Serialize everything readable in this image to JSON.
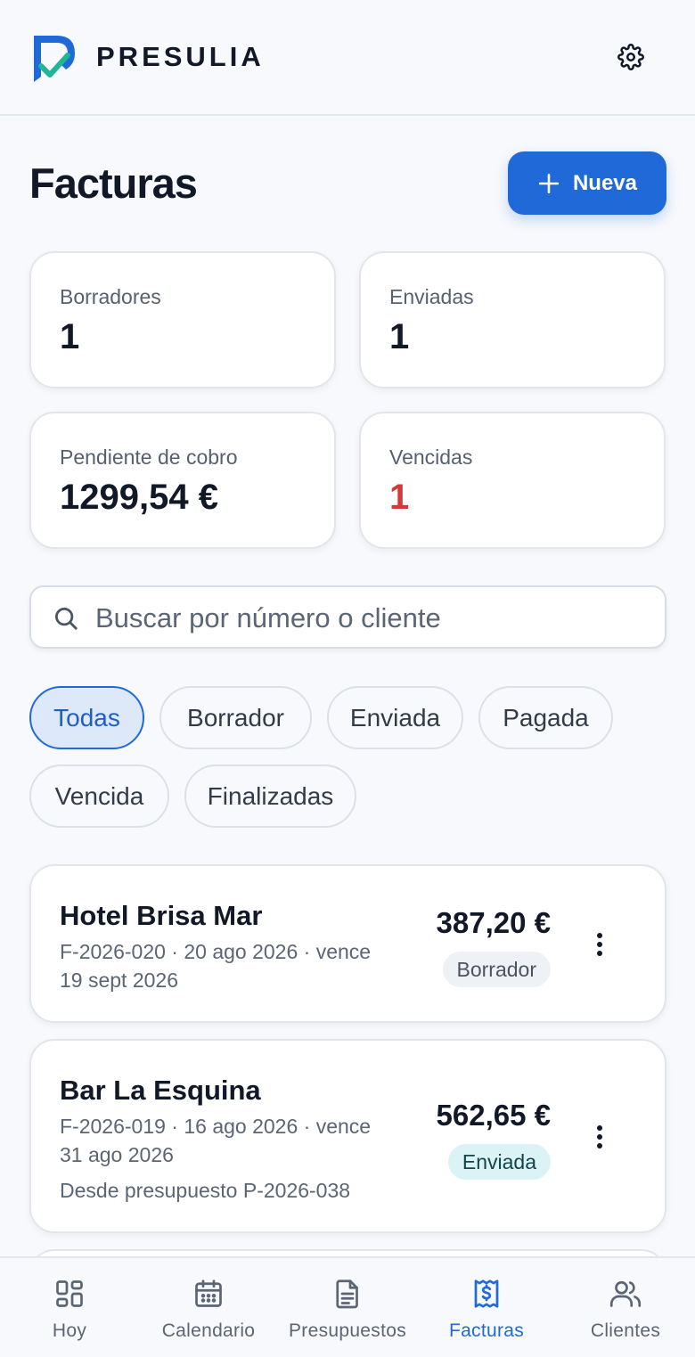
{
  "app": {
    "brand": "PRESULIA"
  },
  "page": {
    "title": "Facturas",
    "new_button_label": "Nueva"
  },
  "stats": [
    {
      "label": "Borradores",
      "value": "1"
    },
    {
      "label": "Enviadas",
      "value": "1"
    },
    {
      "label": "Pendiente de cobro",
      "value": "1299,54 €"
    },
    {
      "label": "Vencidas",
      "value": "1",
      "color": "#d23a3a"
    }
  ],
  "search": {
    "placeholder": "Buscar por número o cliente",
    "value": ""
  },
  "filters": [
    {
      "label": "Todas",
      "active": true
    },
    {
      "label": "Borrador",
      "active": false
    },
    {
      "label": "Enviada",
      "active": false
    },
    {
      "label": "Pagada",
      "active": false
    },
    {
      "label": "Vencida",
      "active": false
    },
    {
      "label": "Finalizadas",
      "active": false
    }
  ],
  "invoices": [
    {
      "client": "Hotel Brisa Mar",
      "meta": "F-2026-020 · 20 ago 2026 · vence 19 sept 2026",
      "note": "",
      "amount": "387,20 €",
      "status": "Borrador"
    },
    {
      "client": "Bar La Esquina",
      "meta": "F-2026-019 · 16 ago 2026 · vence 31 ago 2026",
      "note": "Desde presupuesto P-2026-038",
      "amount": "562,65 €",
      "status": "Enviada"
    }
  ],
  "nav": [
    {
      "label": "Hoy",
      "icon": "dashboard-grid-icon",
      "active": false
    },
    {
      "label": "Calendario",
      "icon": "calendar-icon",
      "active": false
    },
    {
      "label": "Presupuestos",
      "icon": "document-icon",
      "active": false
    },
    {
      "label": "Facturas",
      "icon": "invoice-dollar-icon",
      "active": true
    },
    {
      "label": "Clientes",
      "icon": "users-icon",
      "active": false
    }
  ],
  "colors": {
    "accent": "#1f6ad8",
    "overdue": "#d23a3a",
    "logo_check": "#1fb597"
  }
}
